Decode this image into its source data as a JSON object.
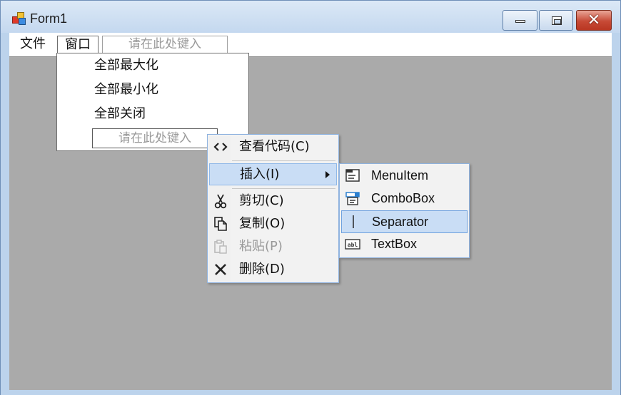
{
  "window": {
    "title": "Form1"
  },
  "menu_strip": {
    "items": [
      {
        "label": "文件"
      },
      {
        "label": "窗口"
      }
    ],
    "type_here": "请在此处键入"
  },
  "window_menu": {
    "items": [
      {
        "label": "全部最大化"
      },
      {
        "label": "全部最小化"
      },
      {
        "label": "全部关闭"
      }
    ],
    "type_here": "请在此处键入"
  },
  "context_menu": {
    "items": [
      {
        "label": "查看代码(C)",
        "icon": "code-brackets-icon"
      },
      {
        "label": "插入(I)",
        "icon": "",
        "highlighted": true,
        "has_submenu": true
      },
      {
        "label": "剪切(C)",
        "icon": "scissors-icon"
      },
      {
        "label": "复制(O)",
        "icon": "copy-icon"
      },
      {
        "label": "粘贴(P)",
        "icon": "paste-icon",
        "disabled": true
      },
      {
        "label": "删除(D)",
        "icon": "delete-x-icon"
      }
    ]
  },
  "insert_submenu": {
    "items": [
      {
        "label": "MenuItem",
        "icon": "menuitem-icon"
      },
      {
        "label": "ComboBox",
        "icon": "combobox-icon"
      },
      {
        "label": "Separator",
        "icon": "separator-icon",
        "highlighted": true
      },
      {
        "label": "TextBox",
        "icon": "textbox-icon"
      }
    ]
  },
  "colors": {
    "client_background": "#aaaaaa",
    "highlight": "#c9ddf5",
    "close_button": "#c74a36"
  }
}
